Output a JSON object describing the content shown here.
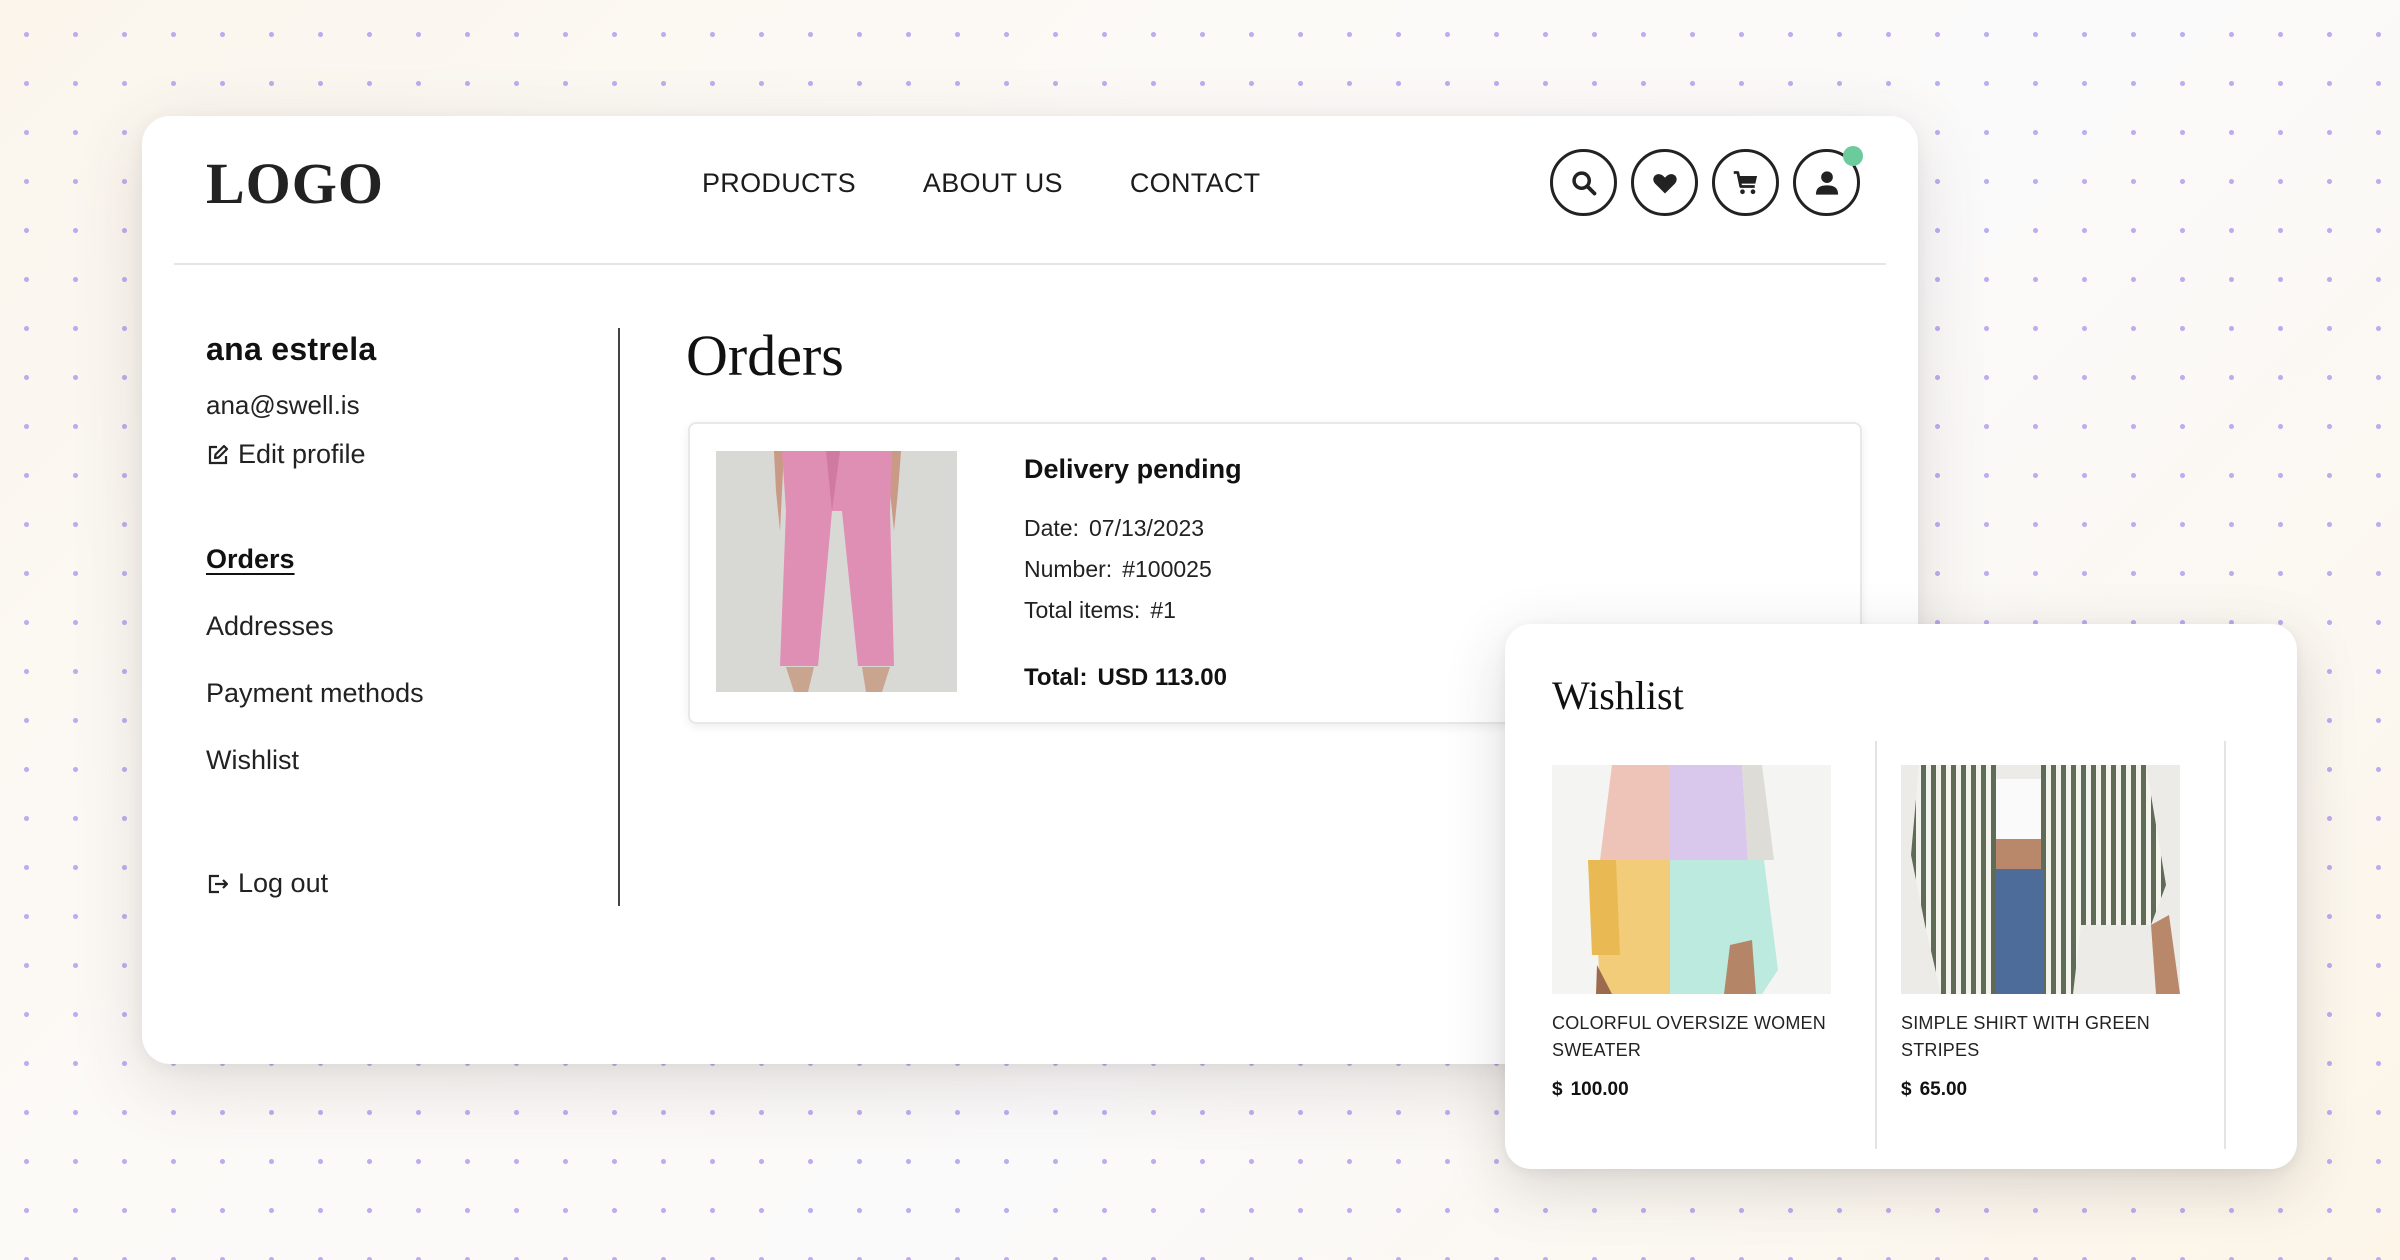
{
  "brand": {
    "logo_text": "LOGO"
  },
  "nav": {
    "links": [
      {
        "label": "PRODUCTS"
      },
      {
        "label": "ABOUT US"
      },
      {
        "label": "CONTACT"
      }
    ]
  },
  "header_icons": {
    "search": "search-icon",
    "wishlist": "heart-icon",
    "cart": "cart-icon",
    "account": "user-icon",
    "account_notification_color": "#6ccb9b"
  },
  "user": {
    "name": "ana estrela",
    "email": "ana@swell.is",
    "edit_profile_label": "Edit profile"
  },
  "sidebar": {
    "items": [
      {
        "label": "Orders",
        "active": true
      },
      {
        "label": "Addresses",
        "active": false
      },
      {
        "label": "Payment methods",
        "active": false
      },
      {
        "label": "Wishlist",
        "active": false
      }
    ],
    "logout_label": "Log out"
  },
  "orders": {
    "title": "Orders",
    "list": [
      {
        "status": "Delivery pending",
        "date_label": "Date:",
        "date": "07/13/2023",
        "number_label": "Number:",
        "number": "#100025",
        "items_label": "Total items:",
        "items": "#1",
        "total_label": "Total:",
        "total": "USD 113.00",
        "image": "pink wide-leg jeans"
      }
    ]
  },
  "wishlist": {
    "title": "Wishlist",
    "items": [
      {
        "name": "COLORFUL OVERSIZE WOMEN SWEATER",
        "currency": "$",
        "price": "100.00",
        "image": "colorblock pastel sweater"
      },
      {
        "name": "SIMPLE SHIRT WITH GREEN STRIPES",
        "currency": "$",
        "price": "65.00",
        "image": "green striped shirt"
      }
    ]
  }
}
